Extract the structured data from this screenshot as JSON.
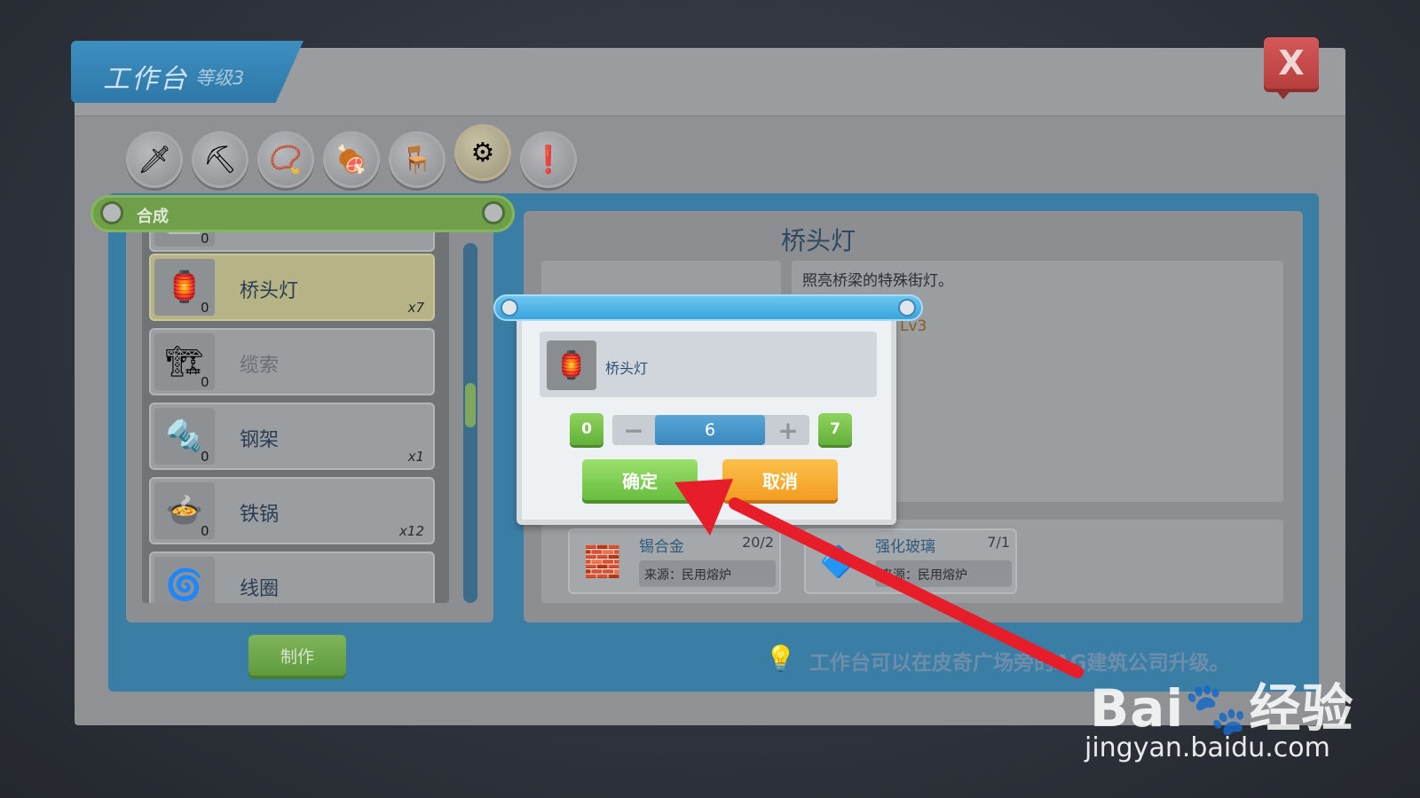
{
  "window": {
    "title": "工作台",
    "level": "等级3",
    "close_label": "X"
  },
  "categories": [
    {
      "name": "weapon",
      "icon": "🗡"
    },
    {
      "name": "tools",
      "icon": "⛏"
    },
    {
      "name": "accessory",
      "icon": "📿"
    },
    {
      "name": "food",
      "icon": "🍖"
    },
    {
      "name": "furniture",
      "icon": "🪑"
    },
    {
      "name": "parts",
      "icon": "⚙"
    },
    {
      "name": "special",
      "icon": "❗"
    }
  ],
  "section": {
    "label": "合成"
  },
  "list": [
    {
      "label": "",
      "count": "0",
      "qty": "",
      "icon": "⬜"
    },
    {
      "label": "桥头灯",
      "count": "0",
      "qty": "x7",
      "icon": "🏮"
    },
    {
      "label": "缆索",
      "count": "0",
      "qty": "",
      "icon": "🏗"
    },
    {
      "label": "钢架",
      "count": "0",
      "qty": "x1",
      "icon": "🔩"
    },
    {
      "label": "铁锅",
      "count": "0",
      "qty": "x12",
      "icon": "🍲"
    },
    {
      "label": "线圈",
      "count": "",
      "qty": "",
      "icon": "🌀"
    }
  ],
  "make_label": "制作",
  "detail": {
    "title": "桥头灯",
    "description": "照亮桥梁的特殊街灯。",
    "level_fragment": "Lv3"
  },
  "materials": [
    {
      "name": "锡合金",
      "amount": "20/2",
      "source": "来源：民用熔炉",
      "icon": "🧱"
    },
    {
      "name": "强化玻璃",
      "amount": "7/1",
      "source": "来源：民用熔炉",
      "icon": "🔷"
    }
  ],
  "tip": {
    "icon": "💡",
    "text": "工作台可以在皮奇广场旁的AG建筑公司升级。"
  },
  "dialog": {
    "item_name": "桥头灯",
    "item_icon": "🏮",
    "min": "0",
    "max": "7",
    "minus": "−",
    "plus": "+",
    "value": "6",
    "confirm_label": "确定",
    "cancel_label": "取消"
  },
  "watermark": {
    "logo": "Bai🐾经验",
    "url": "jingyan.baidu.com"
  },
  "colors": {
    "arrow": "#e81d2a",
    "accent_blue": "#3b7ea5",
    "confirm_green": "#68bd3f",
    "cancel_orange": "#f39d22"
  }
}
